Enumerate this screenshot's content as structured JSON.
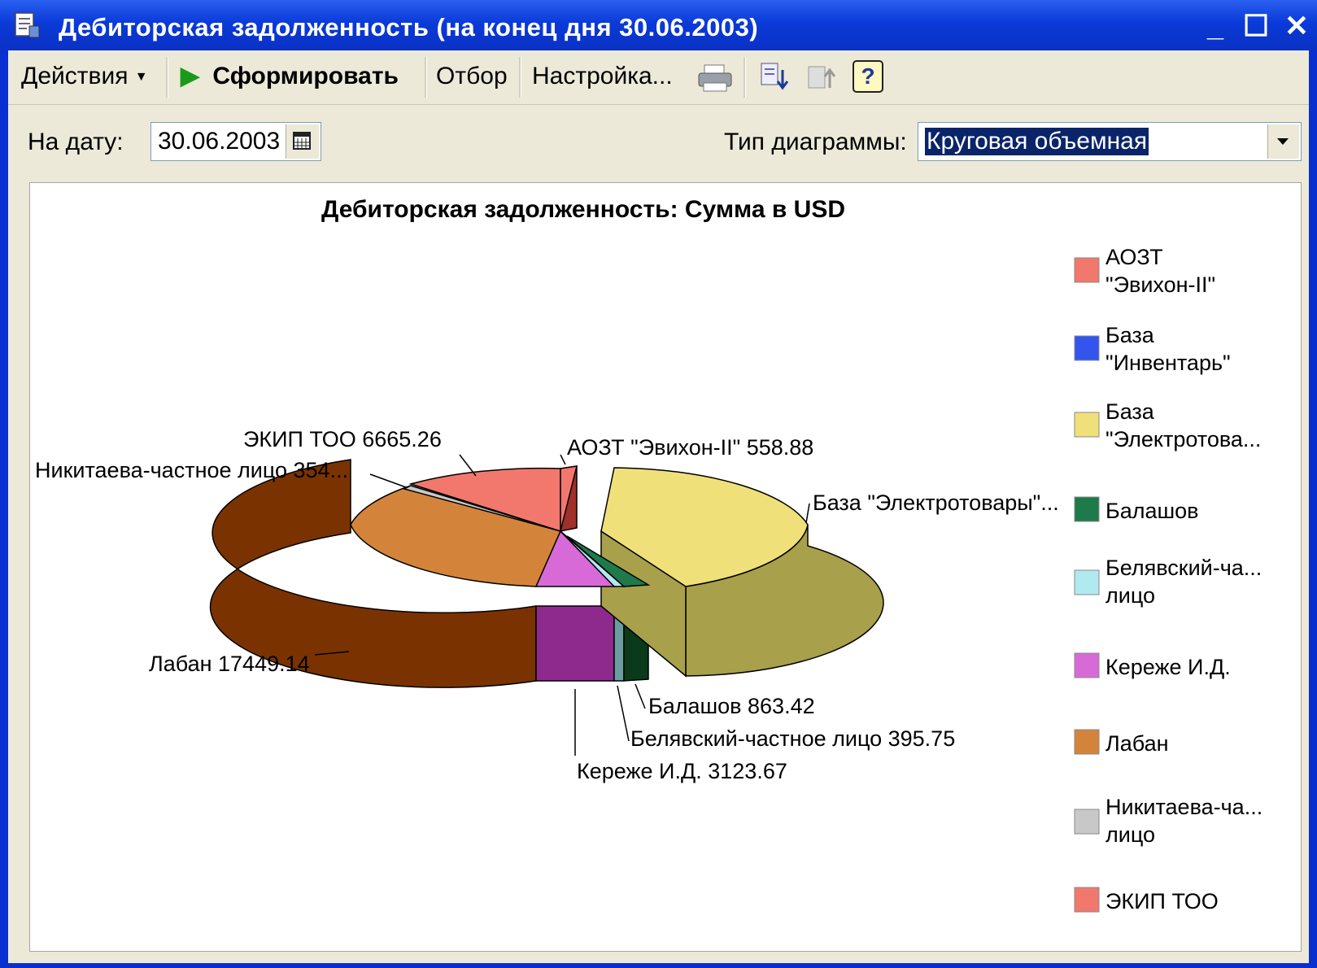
{
  "window": {
    "title": "Дебиторская задолженность (на конец дня 30.06.2003)",
    "controls": {
      "minimize": "_",
      "maximize": "☐",
      "close": "✕"
    }
  },
  "toolbar": {
    "actions_label": "Действия",
    "generate_label": "Сформировать",
    "filter_label": "Отбор",
    "settings_label": "Настройка...",
    "icons": [
      "printer-icon",
      "download-icon",
      "upload-icon",
      "help-icon"
    ],
    "help_label": "?"
  },
  "form": {
    "date_label": "На дату:",
    "date_value": "30.06.2003",
    "chart_type_label": "Тип диаграммы:",
    "chart_type_value": "Круговая объемная"
  },
  "chart_data": {
    "type": "pie",
    "title": "Дебиторская задолженность: Сумма в USD",
    "slices": [
      {
        "name": "АОЗТ \"Эвихон-II\"",
        "value": 558.88,
        "label": "АОЗТ \"Эвихон-II\" 558.88",
        "color": "#f2786e"
      },
      {
        "name": "База \"Инвентарь\"",
        "value": 0,
        "label": "",
        "color": "#3355ee"
      },
      {
        "name": "База \"Электротовары\"",
        "value": null,
        "label": "База \"Электротовары\"...",
        "color": "#f0e07a"
      },
      {
        "name": "Балашов",
        "value": 863.42,
        "label": "Балашов 863.42",
        "color": "#1e7a4a"
      },
      {
        "name": "Белявский-частное лицо",
        "value": 395.75,
        "label": "Белявский-частное лицо 395.75",
        "color": "#b0eaf0"
      },
      {
        "name": "Кереже И.Д.",
        "value": 3123.67,
        "label": "Кереже И.Д. 3123.67",
        "color": "#d86ad8"
      },
      {
        "name": "Лабан",
        "value": 17449.14,
        "label": "Лабан 17449.14",
        "color": "#d4843a"
      },
      {
        "name": "Никитаева-частное лицо",
        "value": 354,
        "label": "Никитаева-частное лицо 354...",
        "color": "#c8c8c8"
      },
      {
        "name": "ЭКИП ТОО",
        "value": 6665.26,
        "label": "ЭКИП ТОО 6665.26",
        "color": "#f2786e"
      }
    ],
    "legend": [
      {
        "text": "АОЗТ \"Эвихон-II\"",
        "color": "#f2786e"
      },
      {
        "text": "База \"Инвентарь\"",
        "color": "#3355ee"
      },
      {
        "text": "База \"Электротова...",
        "color": "#f0e07a"
      },
      {
        "text": "Балашов",
        "color": "#1e7a4a"
      },
      {
        "text": "Белявский-ча... лицо",
        "color": "#b0eaf0"
      },
      {
        "text": "Кереже И.Д.",
        "color": "#d86ad8"
      },
      {
        "text": "Лабан",
        "color": "#d4843a"
      },
      {
        "text": "Никитаева-ча... лицо",
        "color": "#c8c8c8"
      },
      {
        "text": "ЭКИП ТОО",
        "color": "#f2786e"
      }
    ],
    "legend_position": "right"
  }
}
